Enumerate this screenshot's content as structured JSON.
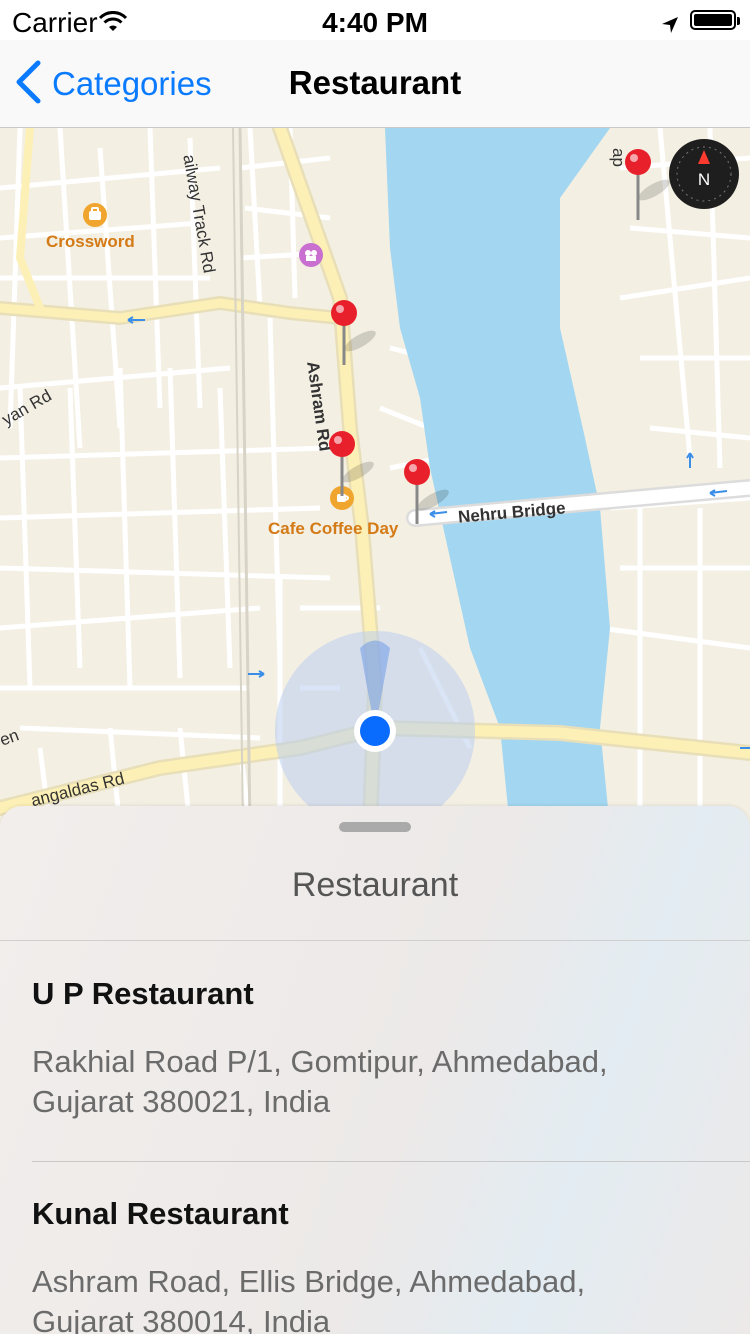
{
  "status_bar": {
    "carrier": "Carrier",
    "time": "4:40 PM"
  },
  "nav": {
    "back_label": "Categories",
    "title": "Restaurant"
  },
  "map": {
    "labels": {
      "railway": "ailway Track Rd",
      "ashram": "Ashram Rd",
      "nehru": "Nehru Bridge",
      "left_road": "yan Rd",
      "bottom_road": "angaldas Rd",
      "edge_left": "en",
      "edge_top_right": "ap"
    },
    "pois": {
      "crossword": "Crossword",
      "cafe": "Cafe Coffee Day"
    },
    "compass_letter": "N",
    "colors": {
      "water": "#a3d6f0",
      "road": "#fdf0b6",
      "pin": "#e8202b",
      "user_dot": "#0a6cff"
    }
  },
  "sheet": {
    "title": "Restaurant",
    "results": [
      {
        "name": "U P Restaurant",
        "address": "Rakhial Road P/1, Gomtipur, Ahmedabad, Gujarat 380021, India"
      },
      {
        "name": "Kunal Restaurant",
        "address": "Ashram Road, Ellis Bridge, Ahmedabad, Gujarat 380014, India"
      }
    ]
  }
}
